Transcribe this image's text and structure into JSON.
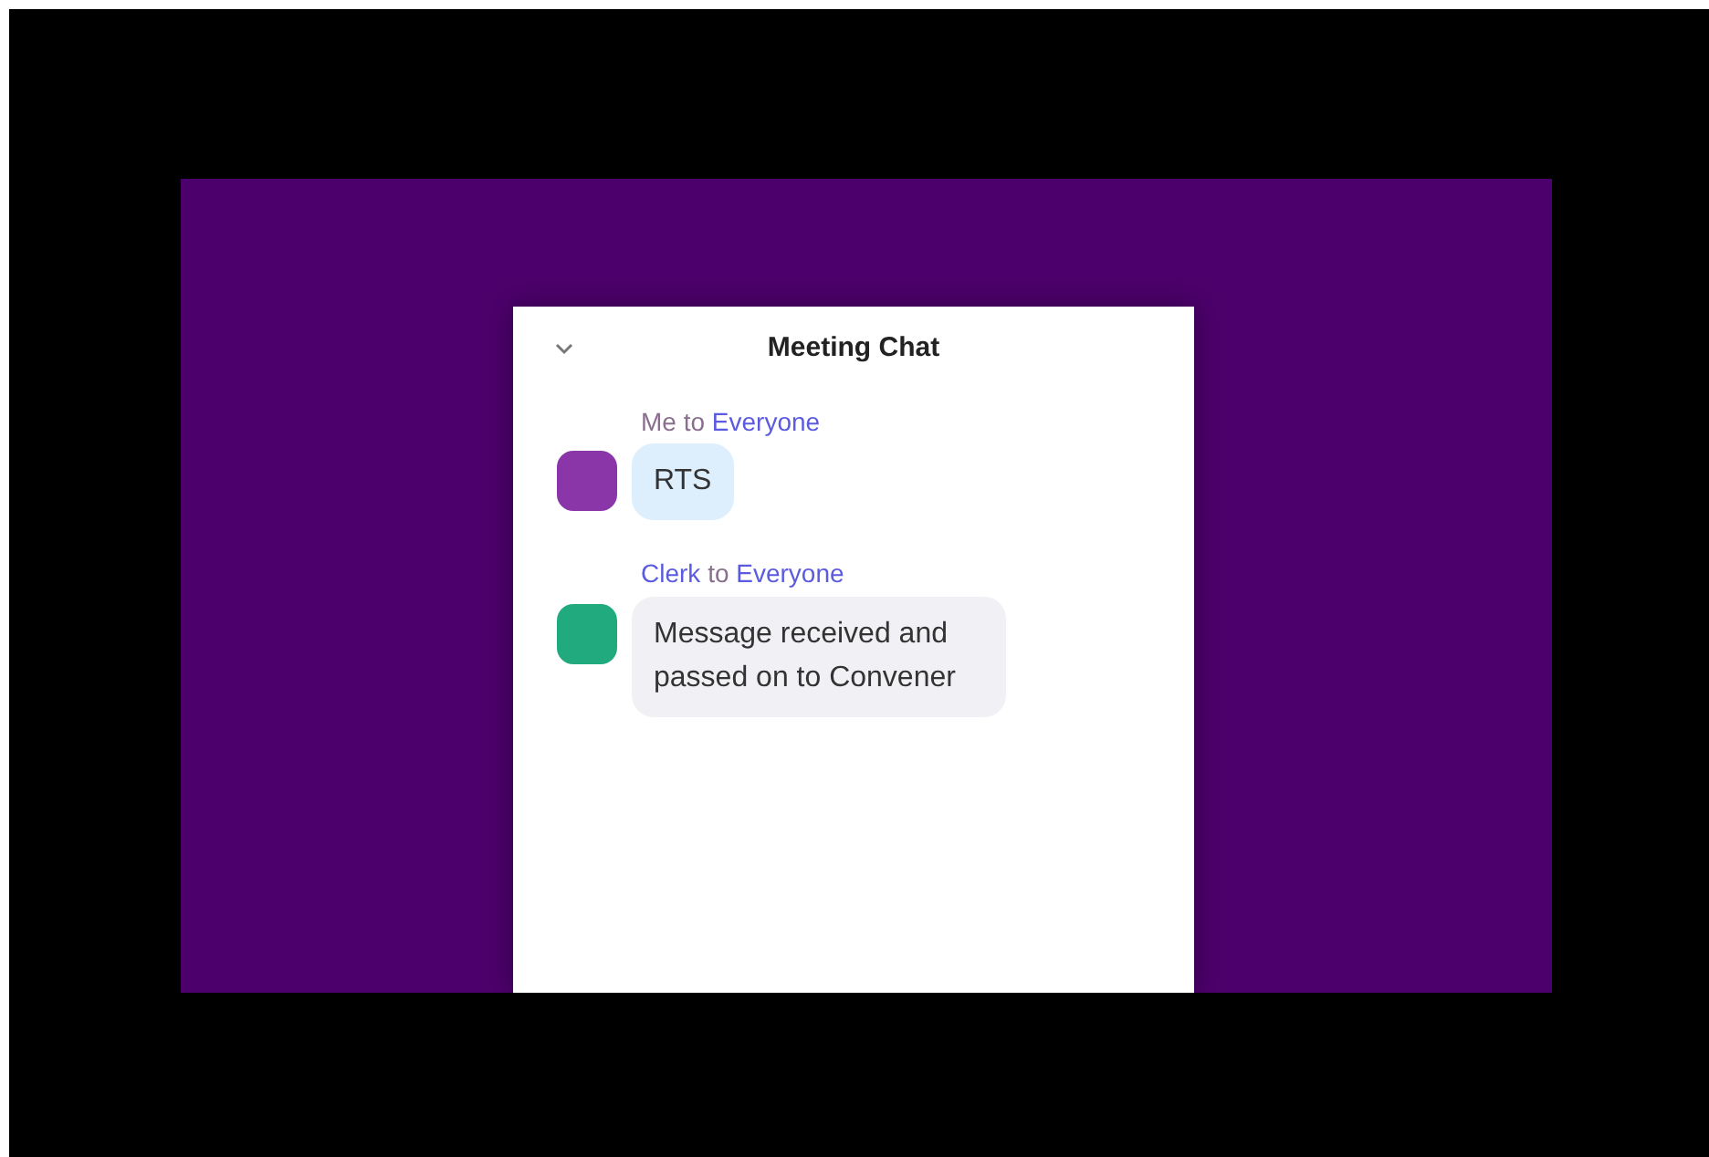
{
  "chat": {
    "title": "Meeting Chat",
    "messages": [
      {
        "sender": "Me",
        "to": "to",
        "recipient": "Everyone",
        "own": true,
        "color": "#8a35a8",
        "text": "RTS"
      },
      {
        "sender": "Clerk",
        "to": "to",
        "recipient": "Everyone",
        "own": false,
        "color": "#22aa7f",
        "text": "Message received and passed on to Convener"
      }
    ]
  }
}
